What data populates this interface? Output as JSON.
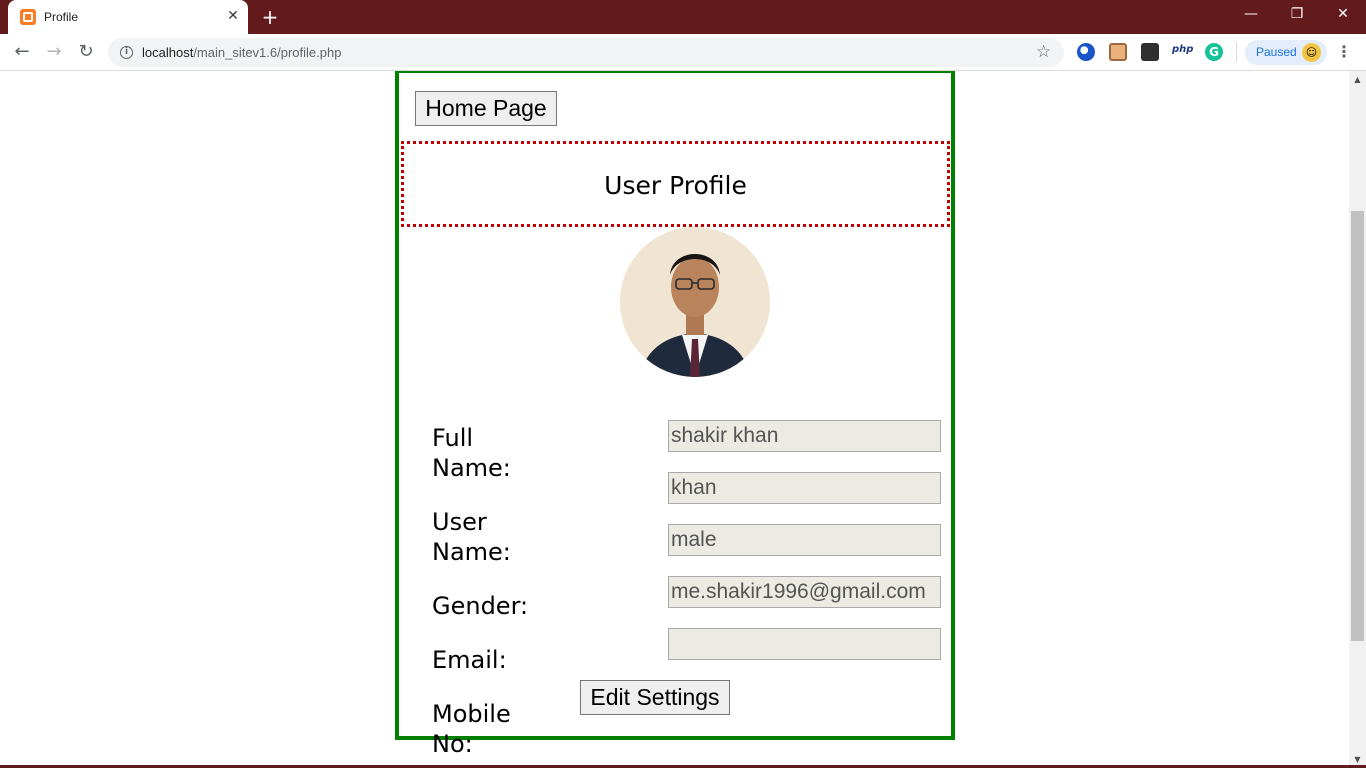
{
  "browser": {
    "tab_title": "Profile",
    "tab_close": "✕",
    "new_tab": "+",
    "url_host": "localhost",
    "url_path": "/main_sitev1.6/profile.php",
    "profile_status": "Paused",
    "window_controls": {
      "minimize": "—",
      "maximize": "❐",
      "close": "✕"
    },
    "extension_php": "php",
    "extension_grammarly": "G"
  },
  "page": {
    "home_button": "Home Page",
    "header_title": "User Profile",
    "labels": {
      "full_name": "Full Name:",
      "user_name": "User Name:",
      "gender": "Gender:",
      "email": "Email:",
      "mobile": "Mobile No:"
    },
    "fields": {
      "full_name": "shakir khan",
      "user_name": "khan",
      "gender": "male",
      "email": "me.shakir1996@gmail.com",
      "mobile": ""
    },
    "edit_button": "Edit Settings"
  },
  "colors": {
    "titlebar": "#621a1c",
    "card_border": "#008000",
    "header_border": "#c00000",
    "field_bg": "#ebebe4"
  }
}
